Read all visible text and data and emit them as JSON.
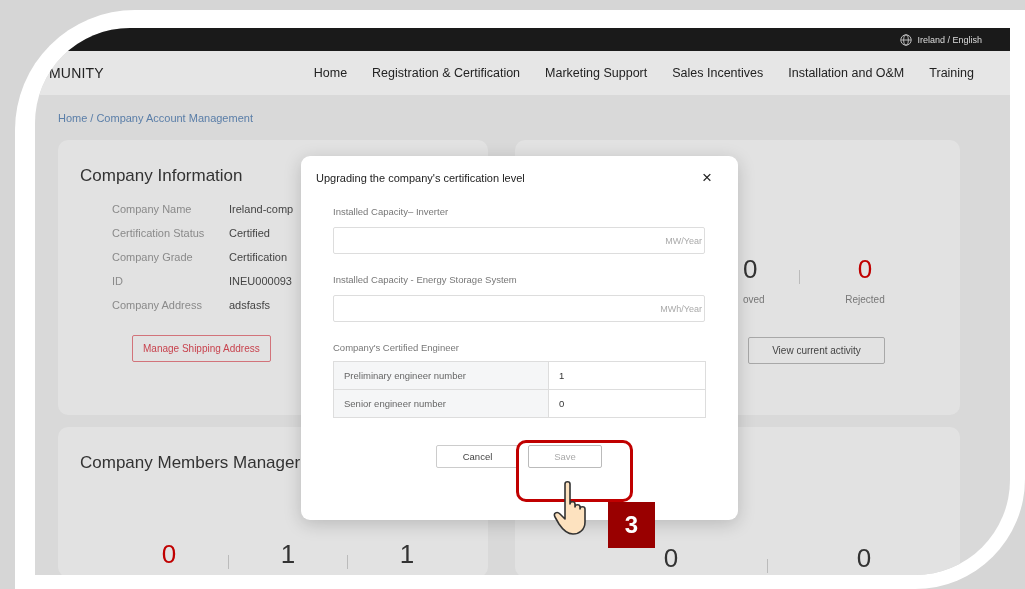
{
  "topbar": {
    "locale": "Ireland / English"
  },
  "nav": {
    "brand": "MUNITY",
    "items": [
      "Home",
      "Registration & Certification",
      "Marketing Support",
      "Sales Incentives",
      "Installation and O&M",
      "Training"
    ]
  },
  "breadcrumb": {
    "items": [
      "Home",
      "Company Account Management"
    ],
    "separator": "/"
  },
  "company_info": {
    "title": "Company Information",
    "fields": [
      {
        "label": "Company Name",
        "value": "Ireland-comp"
      },
      {
        "label": "Certification Status",
        "value": "Certified"
      },
      {
        "label": "Company Grade",
        "value": "Certification"
      },
      {
        "label": "ID",
        "value": "INEU000093"
      },
      {
        "label": "Company Address",
        "value": "adsfasfs"
      }
    ],
    "button": "Manage Shipping Address"
  },
  "activity_card": {
    "stats": [
      {
        "value": "0",
        "label": "oved",
        "color": "#333333"
      },
      {
        "value": "0",
        "label": "Rejected",
        "color": "#c00000"
      }
    ],
    "button": "View current activity"
  },
  "members_card": {
    "title": "Company Members Manager",
    "stats": [
      {
        "value": "0",
        "color": "#c00000"
      },
      {
        "value": "1",
        "color": "#333333"
      },
      {
        "value": "1",
        "color": "#333333"
      }
    ]
  },
  "side_card": {
    "stats": [
      {
        "value": "0",
        "color": "#333333"
      },
      {
        "value": "0",
        "color": "#333333"
      }
    ]
  },
  "modal": {
    "title": "Upgrading the company's certification level",
    "close": "×",
    "fields": [
      {
        "label": "Installed Capacity– Inverter",
        "placeholder": "MW/Year"
      },
      {
        "label": "Installed Capacity - Energy Storage System",
        "placeholder": "MWh/Year"
      }
    ],
    "engineer_label": "Company's Certified Engineer",
    "engineer_rows": [
      {
        "label": "Preliminary engineer number",
        "value": "1"
      },
      {
        "label": "Senior engineer number",
        "value": "0"
      }
    ],
    "buttons": [
      {
        "label": "Cancel",
        "disabled": false
      },
      {
        "label": "Save",
        "disabled": true
      }
    ]
  },
  "annotation": {
    "step": "3"
  }
}
